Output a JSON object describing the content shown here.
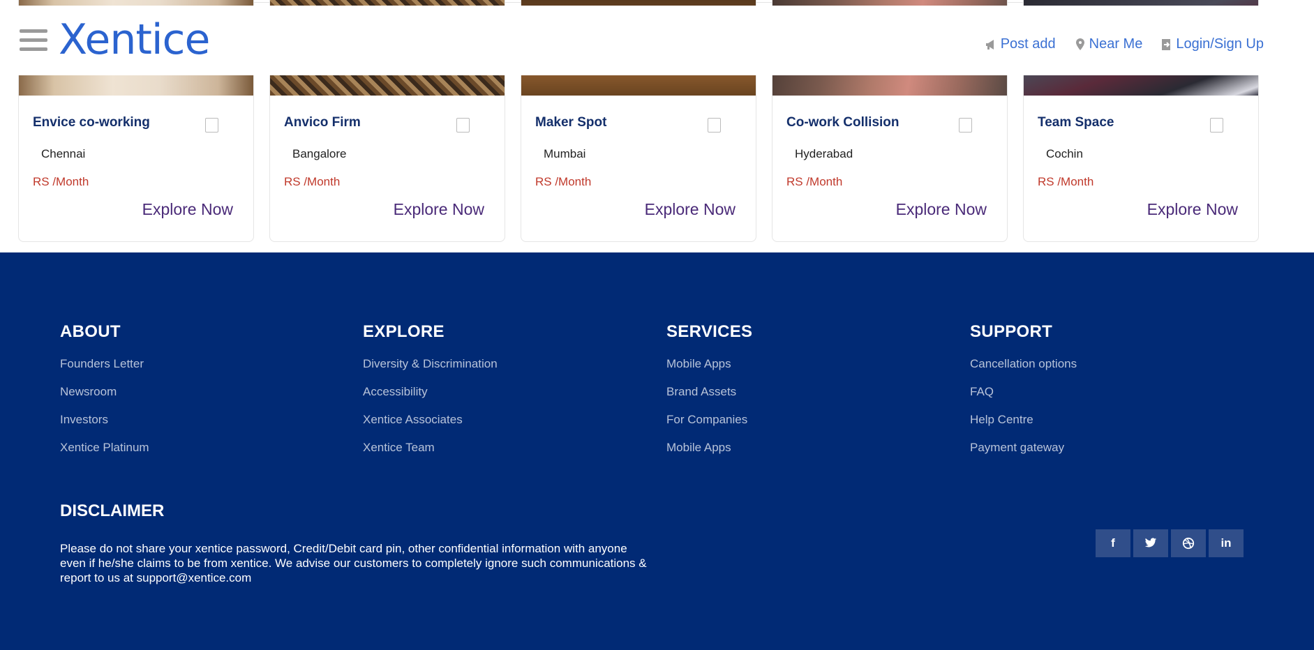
{
  "header": {
    "logo": "Xentice",
    "nav": [
      {
        "label": "Post add",
        "icon": "megaphone-icon"
      },
      {
        "label": "Near Me",
        "icon": "location-pin-icon"
      },
      {
        "label": "Login/Sign Up",
        "icon": "login-icon"
      }
    ]
  },
  "cards": [
    {
      "title": "Envice co-working",
      "city": "Chennai",
      "price": "RS /Month",
      "cta": "Explore Now"
    },
    {
      "title": "Anvico Firm",
      "city": "Bangalore",
      "price": "RS /Month",
      "cta": "Explore Now"
    },
    {
      "title": "Maker Spot",
      "city": "Mumbai",
      "price": "RS /Month",
      "cta": "Explore Now"
    },
    {
      "title": "Co-work Collision",
      "city": "Hyderabad",
      "price": "RS /Month",
      "cta": "Explore Now"
    },
    {
      "title": "Team Space",
      "city": "Cochin",
      "price": "RS /Month",
      "cta": "Explore Now"
    }
  ],
  "footer": {
    "columns": [
      {
        "heading": "ABOUT",
        "links": [
          "Founders Letter",
          "Newsroom",
          "Investors",
          "Xentice Platinum"
        ]
      },
      {
        "heading": "EXPLORE",
        "links": [
          "Diversity & Discrimination",
          "Accessibility",
          "Xentice Associates",
          "Xentice Team"
        ]
      },
      {
        "heading": "SERVICES",
        "links": [
          "Mobile Apps",
          "Brand Assets",
          "For Companies",
          "Mobile Apps"
        ]
      },
      {
        "heading": "SUPPORT",
        "links": [
          "Cancellation options",
          "FAQ",
          "Help Centre",
          "Payment gateway"
        ]
      }
    ],
    "disclaimer_title": "DISCLAIMER",
    "disclaimer_text": "Please do not share your xentice password, Credit/Debit card pin, other confidential information with anyone even if he/she claims to be from xentice. We advise our customers to completely ignore such communications & report to us at support@xentice.com",
    "social": [
      {
        "glyph": "f",
        "icon": "facebook-icon"
      },
      {
        "glyph": "🐦",
        "icon": "twitter-icon"
      },
      {
        "glyph": "⊛",
        "icon": "dribbble-icon"
      },
      {
        "glyph": "in",
        "icon": "linkedin-icon"
      }
    ]
  },
  "colors": {
    "brand_blue": "#2b63cf",
    "footer_bg": "#012a75",
    "price_red": "#c0392b",
    "explore_purple": "#4a2a78"
  }
}
